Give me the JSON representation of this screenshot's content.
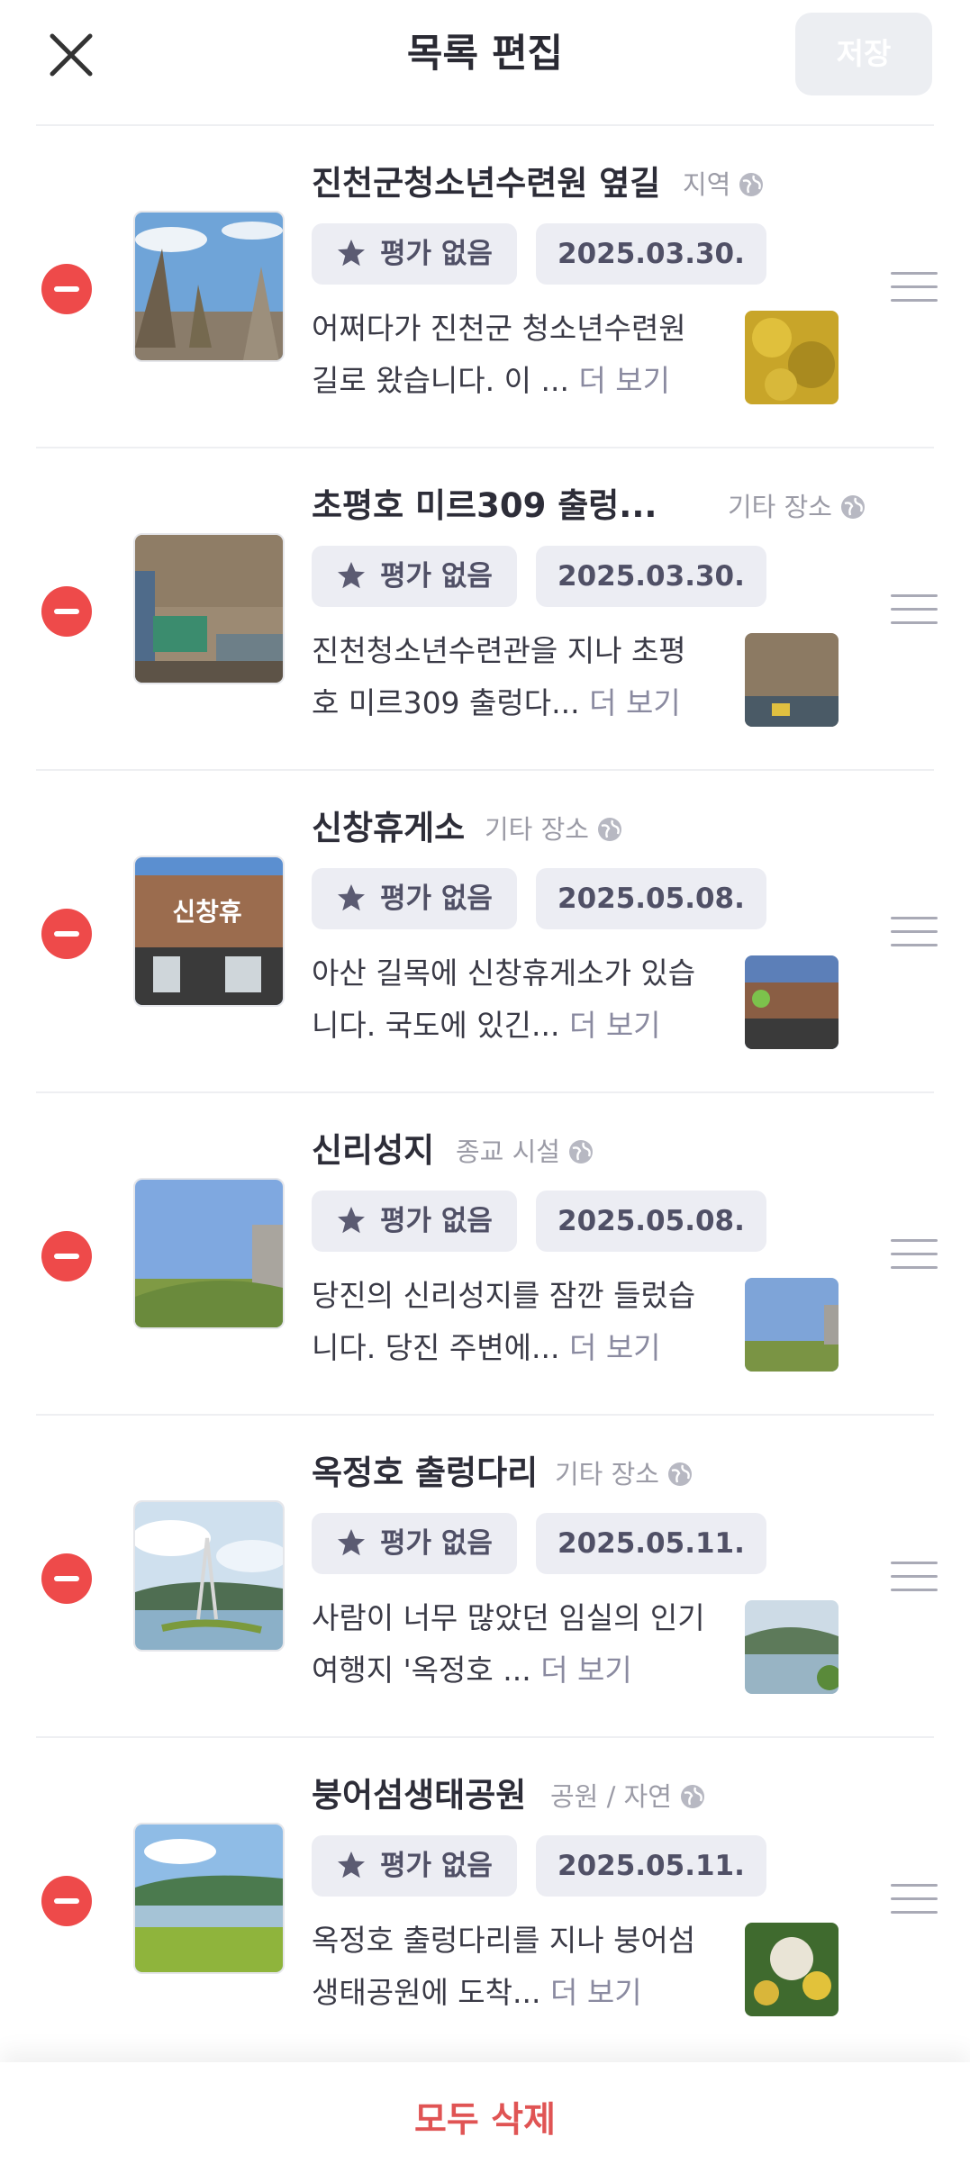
{
  "header": {
    "title": "목록 편집",
    "save_label": "저장",
    "close_icon": "close-icon"
  },
  "items": [
    {
      "name": "진천군청소년수련원 옆길",
      "category": "지역",
      "rating": "평가 없음",
      "date": "2025.03.30.",
      "desc": "어쩌다가 진천군 청소년수련원 길로 왔습니다. 이 ...",
      "more": "더 보기"
    },
    {
      "name": "초평호 미르309 출렁...",
      "category": "기타 장소",
      "rating": "평가 없음",
      "date": "2025.03.30.",
      "desc": "진천청소년수련관을 지나 초평호 미르309 출렁다...",
      "more": "더 보기"
    },
    {
      "name": "신창휴게소",
      "category": "기타 장소",
      "rating": "평가 없음",
      "date": "2025.05.08.",
      "desc": "아산 길목에 신창휴게소가 있습니다. 국도에 있긴...",
      "more": "더 보기"
    },
    {
      "name": "신리성지",
      "category": "종교 시설",
      "rating": "평가 없음",
      "date": "2025.05.08.",
      "desc": "당진의 신리성지를 잠깐 들렀습니다. 당진 주변에...",
      "more": "더 보기"
    },
    {
      "name": "옥정호 출렁다리",
      "category": "기타 장소",
      "rating": "평가 없음",
      "date": "2025.05.11.",
      "desc": "사람이 너무 많았던 임실의 인기 여행지 '옥정호 ...",
      "more": "더 보기"
    },
    {
      "name": "붕어섬생태공원",
      "category": "공원 / 자연",
      "rating": "평가 없음",
      "date": "2025.05.11.",
      "desc": "옥정호 출렁다리를 지나 붕어섬생태공원에 도착...",
      "more": "더 보기"
    }
  ],
  "footer": {
    "delete_all_label": "모두 삭제"
  },
  "colors": {
    "remove": "#ee4a4a",
    "delete_all": "#e05454",
    "chip_bg": "#ecedf3"
  }
}
